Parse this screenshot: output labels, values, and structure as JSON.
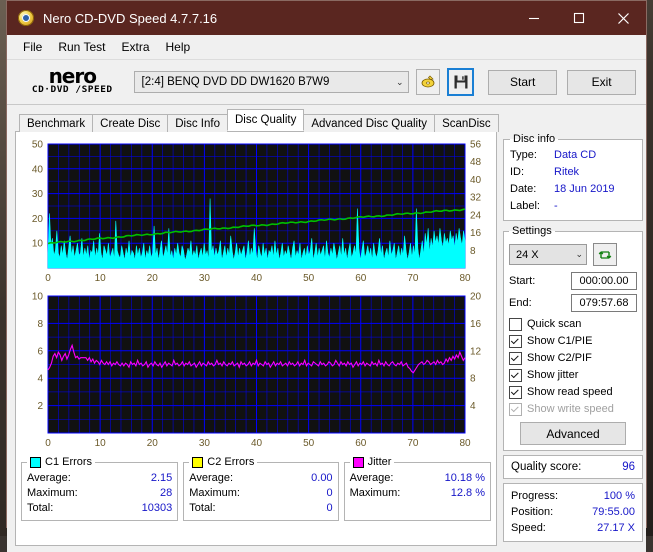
{
  "window": {
    "title": "Nero CD-DVD Speed 4.7.7.16",
    "minimize": "─",
    "maximize": "□",
    "close": "✕"
  },
  "menu": [
    "File",
    "Run Test",
    "Extra",
    "Help"
  ],
  "toolbar": {
    "logo_line1": "nero",
    "logo_line2": "CD·DVD ∕SPEED",
    "drive": "[2:4]   BENQ DVD DD DW1620 B7W9",
    "drive_chevron": "⌄",
    "eject_icon": "eject-disc-icon",
    "save_icon": "save-floppy-icon",
    "start_label": "Start",
    "exit_label": "Exit"
  },
  "tabs": [
    {
      "label": "Benchmark",
      "active": false
    },
    {
      "label": "Create Disc",
      "active": false
    },
    {
      "label": "Disc Info",
      "active": false
    },
    {
      "label": "Disc Quality",
      "active": true
    },
    {
      "label": "Advanced Disc Quality",
      "active": false
    },
    {
      "label": "ScanDisc",
      "active": false
    }
  ],
  "disc_info": {
    "legend": "Disc info",
    "rows": [
      {
        "key": "Type:",
        "value": "Data CD"
      },
      {
        "key": "ID:",
        "value": "Ritek"
      },
      {
        "key": "Date:",
        "value": "18 Jun 2019"
      },
      {
        "key": "Label:",
        "value": "-"
      }
    ]
  },
  "settings": {
    "legend": "Settings",
    "speed": "24 X",
    "speed_chevron": "⌄",
    "refresh_icon": "refresh-icon",
    "start_label": "Start:",
    "start_value": "000:00.00",
    "end_label": "End:",
    "end_value": "079:57.68",
    "checkboxes": [
      {
        "label": "Quick scan",
        "checked": false,
        "disabled": false
      },
      {
        "label": "Show C1/PIE",
        "checked": true,
        "disabled": false
      },
      {
        "label": "Show C2/PIF",
        "checked": true,
        "disabled": false
      },
      {
        "label": "Show jitter",
        "checked": true,
        "disabled": false
      },
      {
        "label": "Show read speed",
        "checked": true,
        "disabled": false
      },
      {
        "label": "Show write speed",
        "checked": true,
        "disabled": true
      }
    ],
    "advanced_label": "Advanced"
  },
  "quality": {
    "label": "Quality score:",
    "value": "96"
  },
  "progress": {
    "rows": [
      {
        "key": "Progress:",
        "value": "100 %"
      },
      {
        "key": "Position:",
        "value": "79:55.00"
      },
      {
        "key": "Speed:",
        "value": "27.17 X"
      }
    ]
  },
  "stats": {
    "c1": {
      "legend": "C1 Errors",
      "color": "#00ffff",
      "rows": [
        {
          "key": "Average:",
          "value": "2.15"
        },
        {
          "key": "Maximum:",
          "value": "28"
        },
        {
          "key": "Total:",
          "value": "10303"
        }
      ]
    },
    "c2": {
      "legend": "C2 Errors",
      "color": "#ffff00",
      "rows": [
        {
          "key": "Average:",
          "value": "0.00"
        },
        {
          "key": "Maximum:",
          "value": "0"
        },
        {
          "key": "Total:",
          "value": "0"
        }
      ]
    },
    "jitter": {
      "legend": "Jitter",
      "color": "#ff00ff",
      "rows": [
        {
          "key": "Average:",
          "value": "10.18 %"
        },
        {
          "key": "Maximum:",
          "value": "12.8 %"
        }
      ]
    }
  },
  "chart_data": [
    {
      "type": "area",
      "name": "c1-errors-graph",
      "title": "",
      "xlabel": "",
      "ylabel": "",
      "xlim": [
        0,
        80
      ],
      "xticks": [
        0,
        10,
        20,
        30,
        40,
        50,
        60,
        70,
        80
      ],
      "ylim_left": [
        0,
        50
      ],
      "yticks_left": [
        10,
        20,
        30,
        40,
        50
      ],
      "ylim_right": [
        0,
        56
      ],
      "yticks_right": [
        8,
        16,
        24,
        32,
        40,
        48,
        56
      ],
      "grid": true,
      "bg": "#111111",
      "gridcolor": "#0000ff",
      "series": [
        {
          "name": "C1 errors",
          "color": "#00ffff",
          "axis": "left",
          "kind": "area",
          "values": [
            6,
            22,
            9,
            12,
            5,
            7,
            15,
            6,
            4,
            9,
            5,
            11,
            6,
            3,
            8,
            13,
            5,
            9,
            4,
            7,
            10,
            5,
            6,
            12,
            4,
            8,
            5,
            9,
            3,
            7,
            6,
            11,
            4,
            8,
            5,
            14,
            6,
            3,
            9,
            7,
            5,
            10,
            4,
            6,
            8,
            3,
            19,
            7,
            5,
            4,
            9,
            6,
            3,
            8,
            5,
            11,
            4,
            7,
            6,
            3,
            9,
            5,
            8,
            4,
            6,
            10,
            3,
            7,
            5,
            9,
            4,
            6,
            17,
            5,
            8,
            3,
            7,
            11,
            4,
            6,
            9,
            5,
            16,
            4,
            7,
            3,
            8,
            5,
            10,
            6,
            4,
            9,
            7,
            3,
            5,
            8,
            6,
            11,
            4,
            7,
            5,
            9,
            3,
            6,
            8,
            4,
            10,
            5,
            7,
            3,
            28,
            6,
            9,
            4,
            8,
            5,
            7,
            11,
            3,
            6,
            9,
            4,
            8,
            5,
            13,
            7,
            3,
            6,
            10,
            4,
            8,
            5,
            7,
            9,
            3,
            6,
            11,
            4,
            8,
            5,
            16,
            7,
            3,
            9,
            6,
            4,
            10,
            5,
            8,
            3,
            7,
            6,
            9,
            4,
            11,
            5,
            8,
            3,
            6,
            10,
            4,
            7,
            5,
            9,
            6,
            3,
            8,
            11,
            4,
            7,
            5,
            10,
            3,
            6,
            8,
            4,
            9,
            5,
            7,
            12,
            3,
            6,
            10,
            4,
            8,
            5,
            7,
            9,
            3,
            11,
            6,
            4,
            8,
            5,
            10,
            7,
            3,
            6,
            9,
            4,
            12,
            5,
            8,
            3,
            7,
            10,
            4,
            6,
            9,
            5,
            24,
            8,
            3,
            7,
            11,
            4,
            6,
            9,
            5,
            8,
            3,
            10,
            6,
            4,
            7,
            12,
            5,
            9,
            3,
            6,
            8,
            4,
            11,
            5,
            7,
            10,
            3,
            6,
            9,
            4,
            8,
            5,
            13,
            7,
            3,
            6,
            10,
            4,
            9,
            5,
            24,
            8,
            3,
            7,
            11,
            5,
            14,
            9,
            16,
            6,
            12,
            8,
            15,
            10,
            13,
            9,
            16,
            11,
            8,
            14,
            10,
            12,
            9,
            15,
            11,
            13,
            8,
            14,
            10,
            16,
            12,
            9,
            15,
            11
          ]
        },
        {
          "name": "Read speed",
          "color": "#00c000",
          "axis": "right",
          "kind": "line",
          "start_value": 11.0,
          "end_value": 26.5,
          "description": "Rising green read-speed curve from ~11X at 0 min to ~26.5X at 80 min (right axis)"
        }
      ]
    },
    {
      "type": "line",
      "name": "jitter-graph",
      "title": "",
      "xlabel": "",
      "ylabel": "",
      "xlim": [
        0,
        80
      ],
      "xticks": [
        0,
        10,
        20,
        30,
        40,
        50,
        60,
        70,
        80
      ],
      "ylim_left": [
        0,
        10
      ],
      "yticks_left": [
        2,
        4,
        6,
        8,
        10
      ],
      "ylim_right": [
        0,
        20
      ],
      "yticks_right": [
        4,
        8,
        12,
        16,
        20
      ],
      "grid": true,
      "bg": "#111111",
      "gridcolor": "#0000ff",
      "series": [
        {
          "name": "Jitter",
          "color": "#ff00ff",
          "axis": "right",
          "kind": "line",
          "average": 10.18,
          "maximum": 12.8,
          "values": [
            9.2,
            9.6,
            10.2,
            11.2,
            11.6,
            11.0,
            11.8,
            11.4,
            10.6,
            11.2,
            11.6,
            10.8,
            11.4,
            12.2,
            12.8,
            11.8,
            11.0,
            11.2,
            10.8,
            11.0,
            11.0,
            11.0,
            11.0,
            10.6,
            11.0,
            10.4,
            10.8,
            10.2,
            10.6,
            10.4,
            10.0,
            10.6,
            10.2,
            10.0,
            10.4,
            10.0,
            10.4,
            9.8,
            10.2,
            10.0,
            10.4,
            10.0,
            9.8,
            10.2,
            9.8,
            10.2,
            10.0,
            9.6,
            10.4,
            10.0,
            10.2,
            9.8,
            10.6,
            10.0,
            10.2,
            9.8,
            10.0,
            10.4,
            9.6,
            10.0,
            10.2,
            9.8,
            10.4,
            10.0,
            9.8,
            10.2,
            9.6,
            10.0,
            10.4,
            9.8,
            10.2,
            10.0,
            9.8,
            10.6,
            10.0,
            10.2,
            9.8,
            10.0,
            10.4,
            9.8,
            10.2,
            10.0,
            10.4,
            9.8,
            10.0,
            10.2,
            9.6,
            10.0,
            10.4,
            9.8,
            10.2,
            10.0,
            9.8,
            10.4,
            10.0,
            10.2,
            9.8,
            10.0,
            10.6,
            10.0,
            10.2,
            9.8,
            10.4,
            10.0,
            9.8,
            10.2,
            10.0,
            10.4,
            9.8,
            10.0,
            10.2,
            9.6,
            10.4,
            10.0,
            10.2,
            9.8,
            10.0,
            10.4,
            9.8,
            10.2,
            10.0,
            10.6,
            9.8,
            10.2,
            10.0,
            9.8,
            10.4,
            10.0,
            10.2,
            9.6,
            10.0,
            10.4,
            9.8,
            10.2,
            10.0,
            10.4,
            9.8,
            10.0,
            10.2,
            9.8,
            10.4,
            10.0,
            10.2,
            9.8,
            10.0,
            10.4,
            9.8,
            10.2,
            10.0,
            10.6,
            9.8,
            10.2,
            10.0,
            9.8,
            10.4,
            10.2,
            10.0,
            9.8,
            10.4,
            10.0,
            10.2,
            9.8,
            10.0,
            10.4,
            10.2,
            9.8,
            10.0,
            10.6,
            10.2,
            9.8,
            10.4,
            10.0,
            10.2,
            9.8,
            10.4,
            10.0,
            10.2,
            9.6,
            10.0,
            10.4,
            9.8,
            10.2,
            10.0,
            10.4,
            9.8,
            10.2,
            10.0,
            9.8,
            10.4,
            10.0,
            10.2,
            9.8,
            10.6,
            10.0,
            10.2,
            9.8,
            10.4,
            10.0,
            9.8,
            10.2,
            10.4,
            10.0,
            9.8,
            10.2,
            10.0,
            10.4,
            9.8,
            10.0,
            10.2,
            9.6,
            9.4,
            9.0,
            8.8,
            9.2,
            9.6,
            10.0,
            10.2,
            10.4,
            10.0,
            10.2,
            10.6,
            10.4,
            10.0,
            10.2,
            10.4,
            10.0,
            10.6,
            10.2,
            10.4,
            10.0,
            10.2,
            10.8,
            10.4,
            11.0,
            10.6,
            11.2,
            10.8,
            11.4,
            11.0,
            11.8,
            11.2,
            10.6,
            11.0
          ]
        },
        {
          "name": "Read speed",
          "color": "#00c000",
          "axis": "left",
          "kind": "line",
          "visible": false
        }
      ]
    }
  ]
}
